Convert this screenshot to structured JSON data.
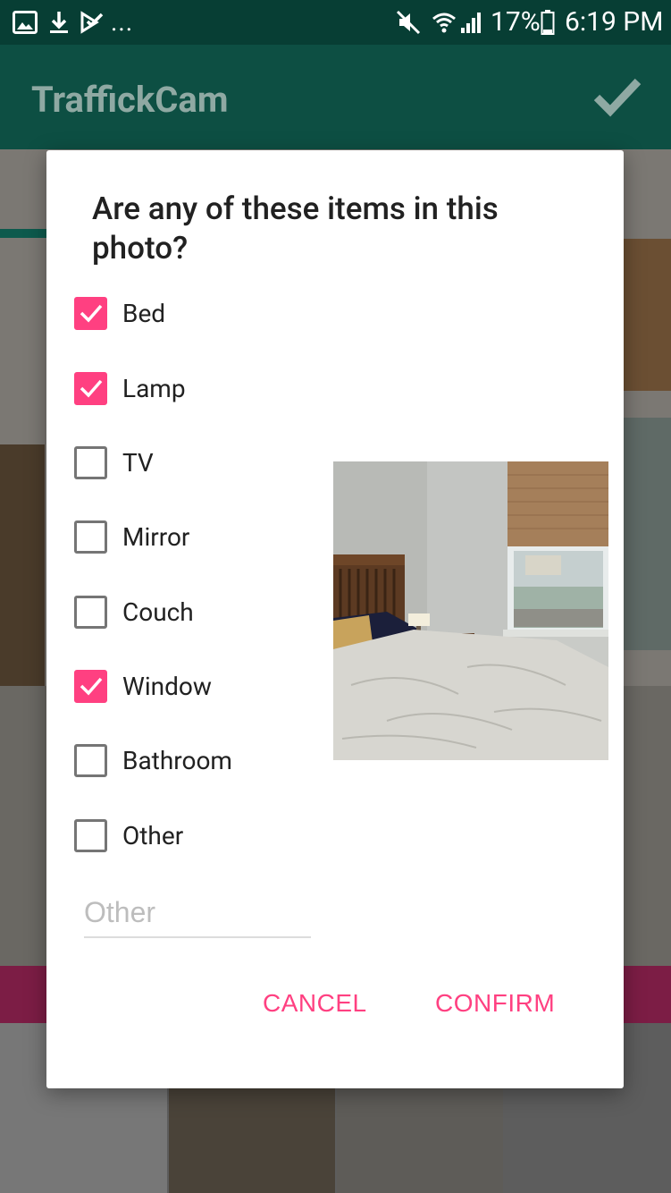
{
  "status_bar": {
    "battery": "17%",
    "time": "6:19 PM",
    "overflow": "..."
  },
  "app_bar": {
    "title": "TraffickCam"
  },
  "dialog": {
    "title": "Are any of these items in this photo?",
    "items": [
      {
        "label": "Bed",
        "checked": true
      },
      {
        "label": "Lamp",
        "checked": true
      },
      {
        "label": "TV",
        "checked": false
      },
      {
        "label": "Mirror",
        "checked": false
      },
      {
        "label": "Couch",
        "checked": false
      },
      {
        "label": "Window",
        "checked": true
      },
      {
        "label": "Bathroom",
        "checked": false
      },
      {
        "label": "Other",
        "checked": false
      }
    ],
    "other_input": {
      "placeholder": "Other",
      "value": ""
    },
    "cancel_label": "CANCEL",
    "confirm_label": "CONFIRM"
  },
  "colors": {
    "accent": "#ff4081",
    "status_bar": "#073e34",
    "app_bar": "#0d4f43"
  }
}
